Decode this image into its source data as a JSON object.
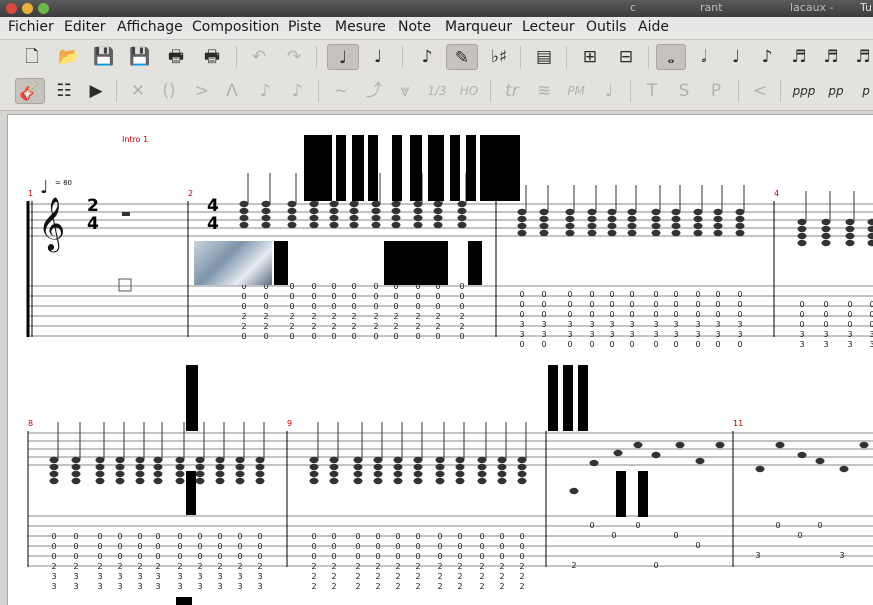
{
  "window": {
    "title_left": "c",
    "title_mid": "rant",
    "title_right": "lacaux -",
    "title_tail": "Tu"
  },
  "menu": [
    "Fichier",
    "Editer",
    "Affichage",
    "Composition",
    "Piste",
    "Mesure",
    "Note",
    "Marqueur",
    "Lecteur",
    "Outils",
    "Aide"
  ],
  "toolbar1_icons": [
    "new-file",
    "open-file",
    "save",
    "save-as",
    "print",
    "print-preview",
    "undo",
    "redo",
    "edit-mode-selected",
    "edit-mode",
    "note-pointer",
    "note-pencil-active",
    "sharp-flat",
    "page-layout",
    "insert-beat",
    "remove-beat",
    "whole-note-active",
    "half-note",
    "quarter-note",
    "eighth-note",
    "sixteenth-note",
    "thirtysecond-note",
    "sixtyfourth-note"
  ],
  "toolbar2_labels": {
    "triplet": "1/3",
    "harmonic": "HO",
    "trill": "tr",
    "palm_mute": "PM",
    "tapping": "T",
    "slap": "S",
    "pop": "P",
    "dyn_ppp": "ppp",
    "dyn_pp": "pp",
    "dyn_p": "p"
  },
  "score": {
    "section_marker": "Intro 1",
    "tempo_value": "= 80",
    "time_sig_1": {
      "top": "2",
      "bottom": "4"
    },
    "time_sig_2": {
      "top": "4",
      "bottom": "4"
    },
    "measure_numbers": [
      "1",
      "2",
      "4",
      "8",
      "9",
      "11"
    ],
    "tab_measure1": [],
    "tab_row1_m2": [
      "0",
      "0",
      "0",
      "2",
      "2",
      "0"
    ],
    "tab_row1_m3": [
      "0",
      "0",
      "0",
      "3",
      "3",
      "0"
    ],
    "tab_row1_m4": [
      "0",
      "0",
      "0",
      "3",
      "3"
    ],
    "tab_row2_m8": [
      "0",
      "0",
      "0",
      "2",
      "3",
      "3"
    ],
    "tab_row2_m9": [
      "0",
      "0",
      "0",
      "2",
      "2",
      "2"
    ],
    "tab_row2_m10": {
      "notes": [
        "0",
        "0",
        "0",
        "0",
        "2",
        "0",
        "0"
      ]
    },
    "tab_row2_m11": [
      "0",
      "0",
      "0",
      "3",
      "3"
    ]
  }
}
